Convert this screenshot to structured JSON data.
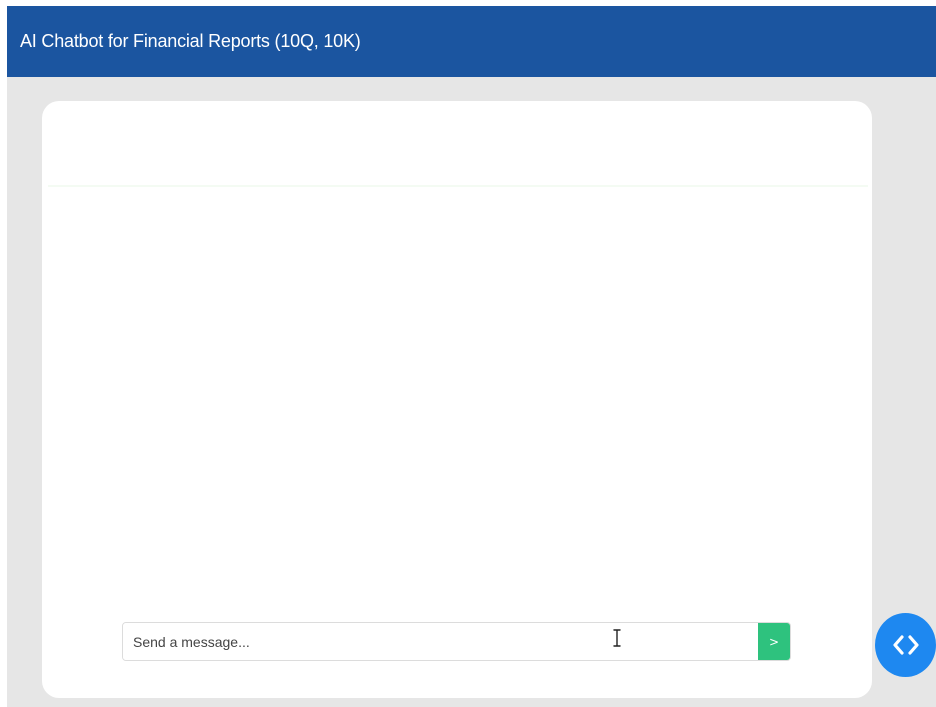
{
  "header": {
    "title": "AI Chatbot for Financial Reports (10Q, 10K)"
  },
  "chat": {
    "input": {
      "placeholder": "Send a message...",
      "value": ""
    },
    "send_button": {
      "label": ">",
      "icon": "chevron-right-icon"
    }
  },
  "floating_button": {
    "icon": "code-brackets-icon"
  },
  "colors": {
    "header_bg": "#1b55a0",
    "page_bg": "#e6e6e6",
    "panel_bg": "#ffffff",
    "send_button": "#2ec27e",
    "floating_button": "#1e88f0"
  }
}
